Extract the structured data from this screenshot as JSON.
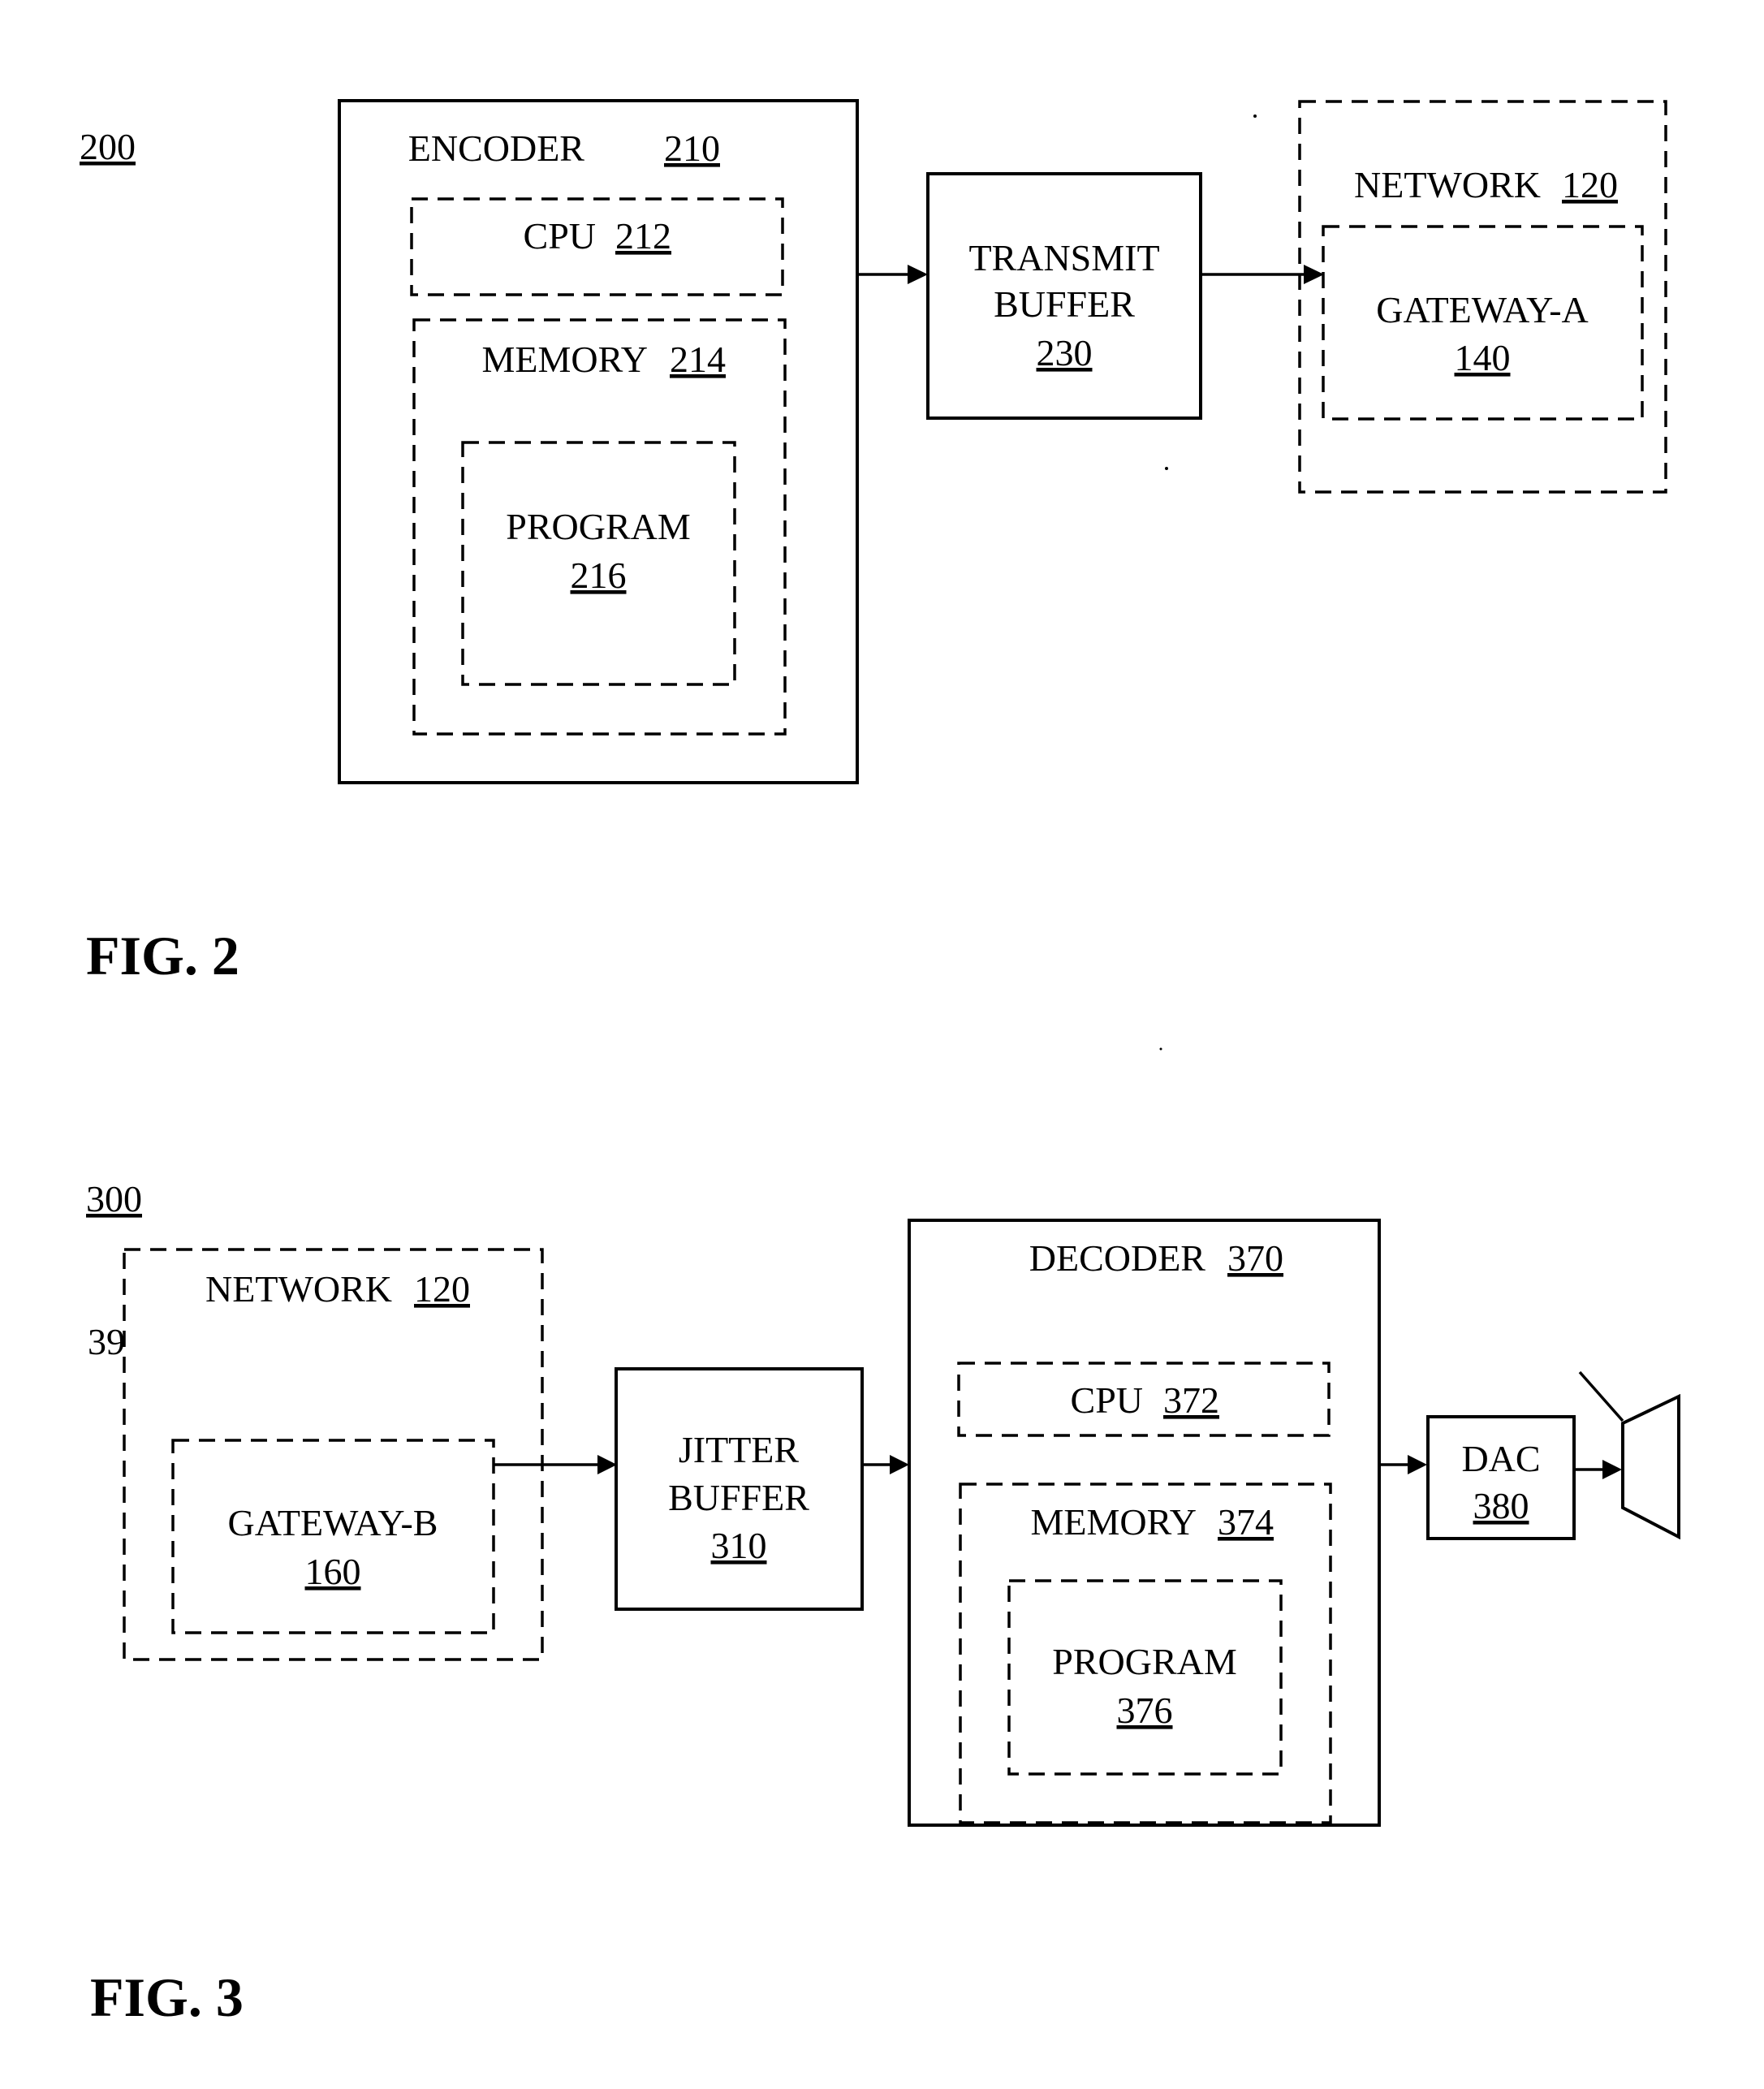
{
  "fig2": {
    "ref": "200",
    "caption": "FIG. 2",
    "encoder": {
      "name": "ENCODER",
      "ref": "210"
    },
    "cpu": {
      "name": "CPU",
      "ref": "212"
    },
    "memory": {
      "name": "MEMORY",
      "ref": "214"
    },
    "program": {
      "name": "PROGRAM",
      "ref": "216"
    },
    "transmit_buffer": {
      "line1": "TRANSMIT",
      "line2": "BUFFER",
      "ref": "230"
    },
    "network": {
      "name": "NETWORK",
      "ref": "120"
    },
    "gateway": {
      "name": "GATEWAY-A",
      "ref": "140"
    }
  },
  "fig3": {
    "ref": "300",
    "stray_label": "39",
    "caption": "FIG. 3",
    "network": {
      "name": "NETWORK",
      "ref": "120"
    },
    "gateway": {
      "name": "GATEWAY-B",
      "ref": "160"
    },
    "jitter_buffer": {
      "line1": "JITTER",
      "line2": "BUFFER",
      "ref": "310"
    },
    "decoder": {
      "name": "DECODER",
      "ref": "370"
    },
    "cpu": {
      "name": "CPU",
      "ref": "372"
    },
    "memory": {
      "name": "MEMORY",
      "ref": "374"
    },
    "program": {
      "name": "PROGRAM",
      "ref": "376"
    },
    "dac": {
      "name": "DAC",
      "ref": "380"
    },
    "speaker_icon": "speaker-icon"
  }
}
